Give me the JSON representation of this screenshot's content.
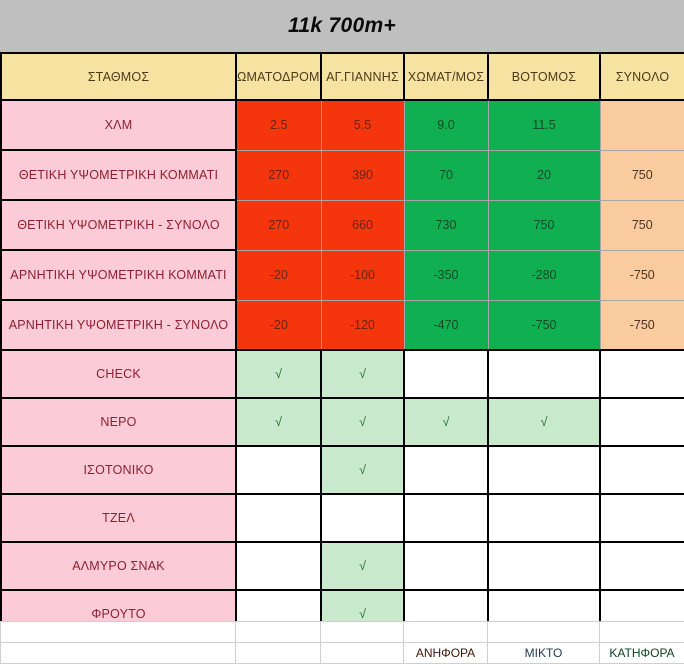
{
  "title": "11k 700m+",
  "table": {
    "columns": [
      "ΣΤΑΘΜΟΣ",
      "ΩΜΑΤΟΔΡΟΜΟ",
      "ΑΓ.ΓΙΑΝΝΗΣ",
      "ΧΩΜΑΤ/ΜΟΣ",
      "ΒΟΤΟΜΟΣ",
      "ΣΥΝΟΛΟ"
    ],
    "rows": [
      {
        "label": "ΧΛΜ",
        "values": [
          "2.5",
          "5.5",
          "9.0",
          "11.5",
          ""
        ]
      },
      {
        "label": "ΘΕΤΙΚΗ ΥΨΟΜΕΤΡΙΚΗ ΚΟΜΜΑΤΙ",
        "values": [
          "270",
          "390",
          "70",
          "20",
          "750"
        ]
      },
      {
        "label": "ΘΕΤΙΚΗ ΥΨΟΜΕΤΡΙΚΗ - ΣΥΝΟΛΟ",
        "values": [
          "270",
          "660",
          "730",
          "750",
          "750"
        ]
      },
      {
        "label": "ΑΡΝΗΤΙΚΗ ΥΨΟΜΕΤΡΙΚΗ ΚΟΜΜΑΤΙ",
        "values": [
          "-20",
          "-100",
          "-350",
          "-280",
          "-750"
        ]
      },
      {
        "label": "ΑΡΝΗΤΙΚΗ ΥΨΟΜΕΤΡΙΚΗ - ΣΥΝΟΛΟ",
        "values": [
          "-20",
          "-120",
          "-470",
          "-750",
          "-750"
        ]
      }
    ],
    "check_rows": [
      {
        "label": "CHECK",
        "values": [
          "√",
          "√",
          "",
          "",
          ""
        ]
      },
      {
        "label": "ΝΕΡΟ",
        "values": [
          "√",
          "√",
          "√",
          "√",
          ""
        ]
      },
      {
        "label": "ΙΣΟΤΟΝΙΚΟ",
        "values": [
          "",
          "√",
          "",
          "",
          ""
        ]
      },
      {
        "label": "ΤΖΕΛ",
        "values": [
          "",
          "",
          "",
          "",
          ""
        ]
      },
      {
        "label": "ΑΛΜΥΡΟ ΣΝΑΚ",
        "values": [
          "",
          "√",
          "",
          "",
          ""
        ]
      },
      {
        "label": "ΦΡΟΥΤΟ",
        "values": [
          "",
          "√",
          "",
          "",
          ""
        ]
      }
    ]
  },
  "legend": [
    {
      "label": "ΑΝΗΦΟΡΑ",
      "color": "#f5360c"
    },
    {
      "label": "ΜΙΚΤΟ",
      "color": "#9fb9d9"
    },
    {
      "label": "ΚΑΤΗΦΟΡΑ",
      "color": "#0faf52"
    }
  ],
  "colors": {
    "title_band": "#bfbfbf",
    "header_cell": "#f7e3a1",
    "label_cell": "#fbcbd7",
    "uphill": "#f5360c",
    "downhill": "#0faf52",
    "total": "#f9cb9f",
    "check": "#c9e9cd"
  }
}
